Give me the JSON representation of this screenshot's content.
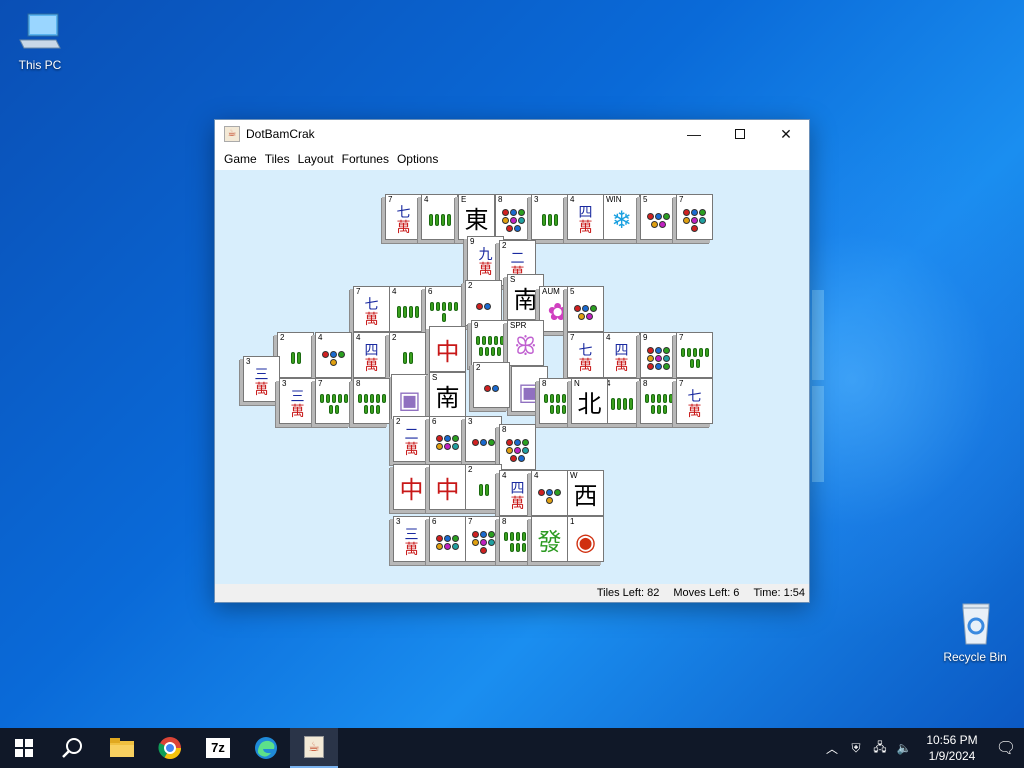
{
  "desktop": {
    "icons": [
      {
        "label": "This PC"
      },
      {
        "label": "Recycle Bin"
      }
    ]
  },
  "window": {
    "title": "DotBamCrak",
    "menu": [
      "Game",
      "Tiles",
      "Layout",
      "Fortunes",
      "Options"
    ],
    "status": {
      "tiles_left": "Tiles Left: 82",
      "moves_left": "Moves Left: 6",
      "time": "Time: 1:54"
    }
  },
  "taskbar": {
    "time": "10:56 PM",
    "date": "1/9/2024",
    "apps": [
      "start-icon",
      "search-icon",
      "file-explorer-icon",
      "chrome-icon",
      "7zip-icon",
      "edge-icon",
      "java-icon"
    ]
  },
  "tiles": [
    {
      "idx": "7",
      "t": "crak",
      "a": "七"
    },
    {
      "idx": "4",
      "t": "bam",
      "n": 4
    },
    {
      "idx": "E",
      "t": "char",
      "c": "東",
      "col": "#000"
    },
    {
      "idx": "8",
      "t": "dot",
      "n": 8
    },
    {
      "idx": "3",
      "t": "bam",
      "n": 3
    },
    {
      "idx": "4",
      "t": "crak",
      "a": "四"
    },
    {
      "idx": "WIN",
      "t": "char",
      "c": "❄",
      "col": "#1aa0e0"
    },
    {
      "idx": "5",
      "t": "dot",
      "n": 5
    },
    {
      "idx": "7",
      "t": "dot",
      "n": 7
    },
    {
      "idx": "9",
      "t": "crak",
      "a": "九"
    },
    {
      "idx": "2",
      "t": "crak",
      "a": "二"
    },
    {
      "idx": "7",
      "t": "crak",
      "a": "七"
    },
    {
      "idx": "4",
      "t": "bam",
      "n": 4
    },
    {
      "idx": "6",
      "t": "bam",
      "n": 6
    },
    {
      "idx": "2",
      "t": "dot",
      "n": 2
    },
    {
      "idx": "S",
      "t": "char",
      "c": "南",
      "col": "#000"
    },
    {
      "idx": "AUM",
      "t": "char",
      "c": "✿",
      "col": "#d040c0"
    },
    {
      "idx": "5",
      "t": "dot",
      "n": 5
    },
    {
      "idx": "3",
      "t": "crak",
      "a": "三"
    },
    {
      "idx": "2",
      "t": "bam",
      "n": 2
    },
    {
      "idx": "4",
      "t": "dot",
      "n": 4
    },
    {
      "idx": "4",
      "t": "crak",
      "a": "四"
    },
    {
      "idx": "2",
      "t": "bam",
      "n": 2
    },
    {
      "idx": "",
      "t": "char",
      "c": "中",
      "col": "#c81818"
    },
    {
      "idx": "9",
      "t": "bam",
      "n": 9
    },
    {
      "idx": "SPR",
      "t": "char",
      "c": "ꕥ",
      "col": "#c060d0"
    },
    {
      "idx": "7",
      "t": "crak",
      "a": "七"
    },
    {
      "idx": "4",
      "t": "crak",
      "a": "四"
    },
    {
      "idx": "9",
      "t": "dot",
      "n": 9
    },
    {
      "idx": "7",
      "t": "bam",
      "n": 7
    },
    {
      "idx": "3",
      "t": "crak",
      "a": "三"
    },
    {
      "idx": "7",
      "t": "bam",
      "n": 7
    },
    {
      "idx": "8",
      "t": "bam",
      "n": 8
    },
    {
      "idx": "",
      "t": "char",
      "c": "▣",
      "col": "#9070c0"
    },
    {
      "idx": "S",
      "t": "char",
      "c": "南",
      "col": "#000"
    },
    {
      "idx": "2",
      "t": "dot",
      "n": 2
    },
    {
      "idx": "",
      "t": "char",
      "c": "▣",
      "col": "#9070c0"
    },
    {
      "idx": "8",
      "t": "bam",
      "n": 8
    },
    {
      "idx": "N",
      "t": "char",
      "c": "北",
      "col": "#000"
    },
    {
      "idx": "4",
      "t": "bam",
      "n": 4
    },
    {
      "idx": "8",
      "t": "bam",
      "n": 8
    },
    {
      "idx": "7",
      "t": "crak",
      "a": "七"
    },
    {
      "idx": "2",
      "t": "crak",
      "a": "二"
    },
    {
      "idx": "6",
      "t": "dot",
      "n": 6
    },
    {
      "idx": "3",
      "t": "dot",
      "n": 3
    },
    {
      "idx": "8",
      "t": "dot",
      "n": 8
    },
    {
      "idx": "",
      "t": "char",
      "c": "中",
      "col": "#c81818"
    },
    {
      "idx": "",
      "t": "char",
      "c": "中",
      "col": "#c81818"
    },
    {
      "idx": "2",
      "t": "bam",
      "n": 2
    },
    {
      "idx": "4",
      "t": "crak",
      "a": "四"
    },
    {
      "idx": "4",
      "t": "dot",
      "n": 4
    },
    {
      "idx": "W",
      "t": "char",
      "c": "西",
      "col": "#000"
    },
    {
      "idx": "3",
      "t": "crak",
      "a": "三"
    },
    {
      "idx": "6",
      "t": "dot",
      "n": 6
    },
    {
      "idx": "7",
      "t": "dot",
      "n": 7
    },
    {
      "idx": "8",
      "t": "bam",
      "n": 8
    },
    {
      "idx": "",
      "t": "char",
      "c": "發",
      "col": "#2a9a20"
    },
    {
      "idx": "1",
      "t": "char",
      "c": "◉",
      "col": "#d03010"
    }
  ]
}
